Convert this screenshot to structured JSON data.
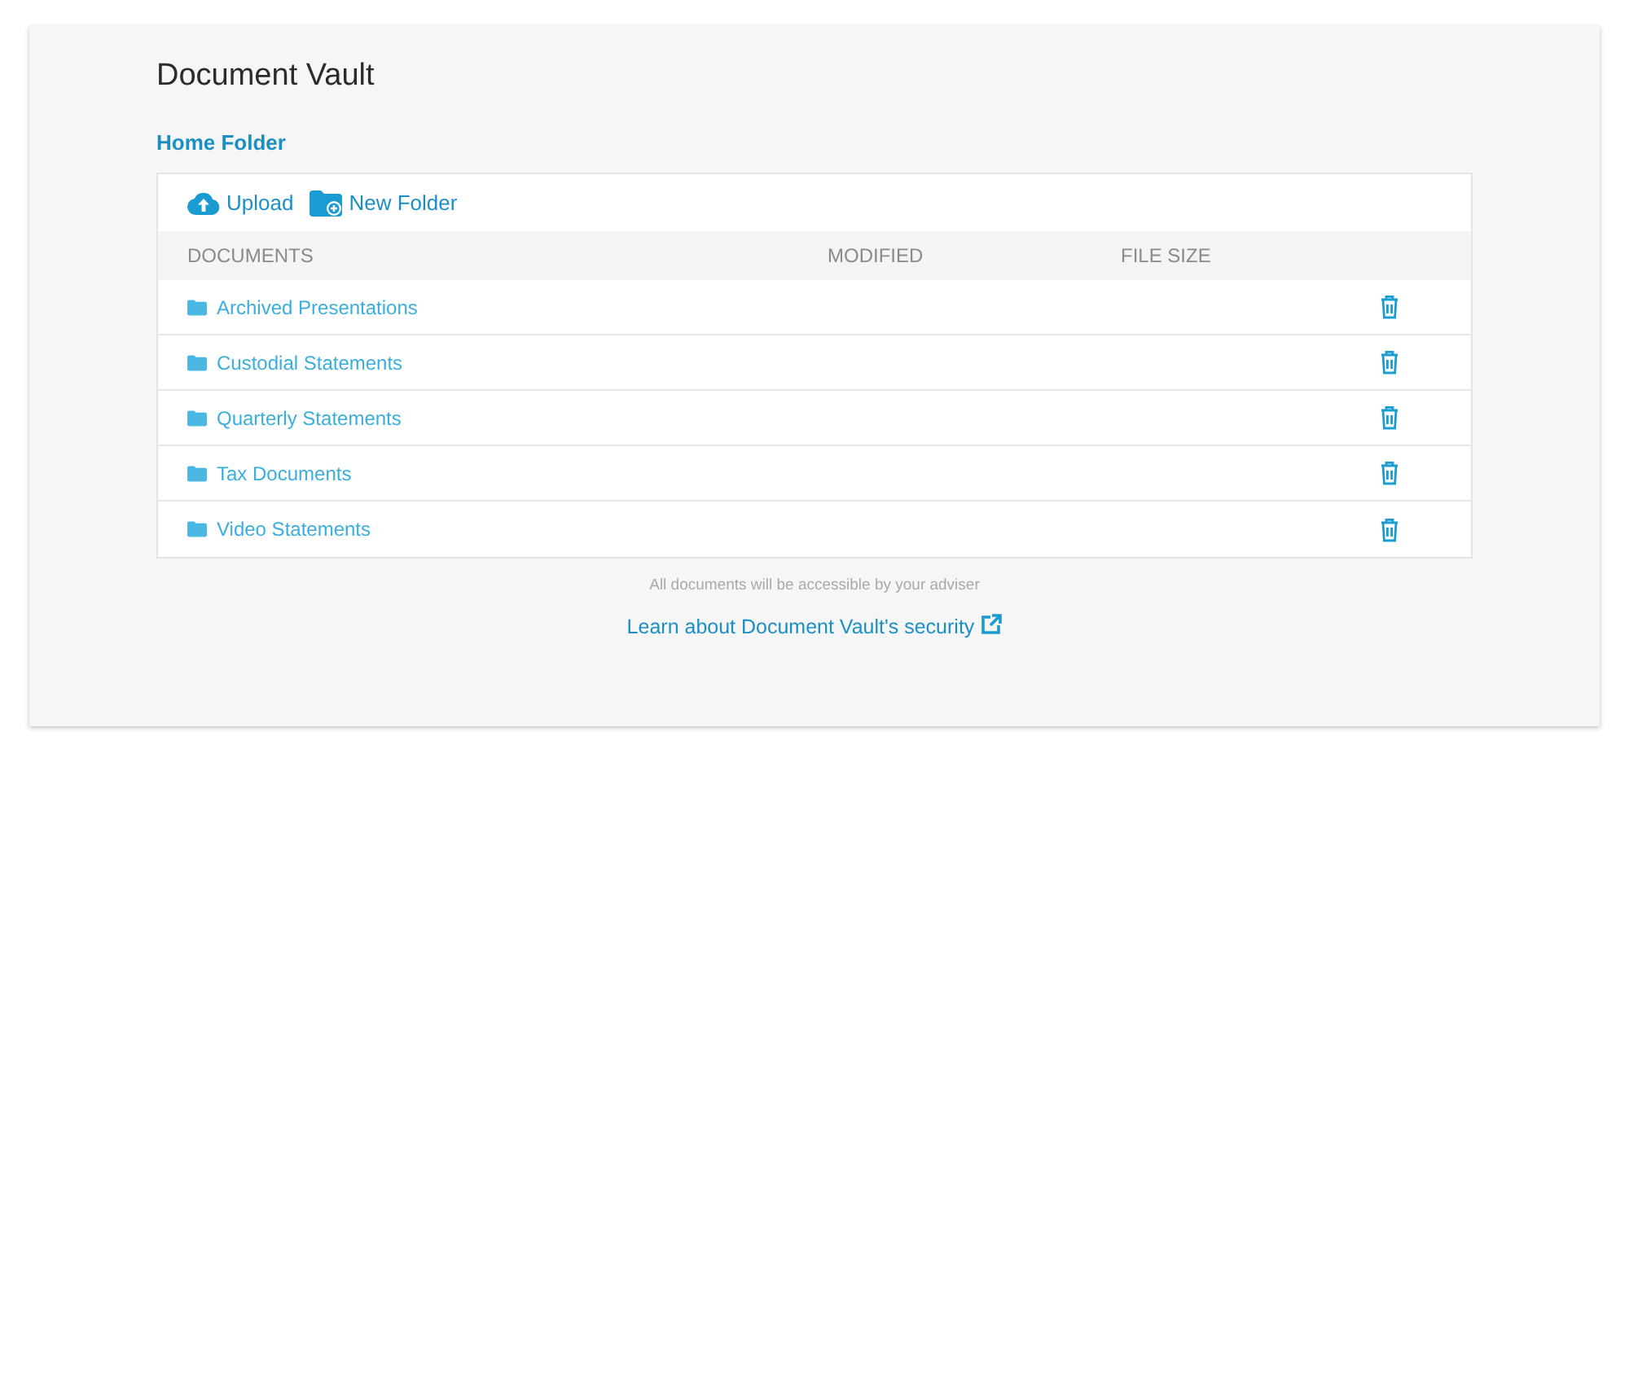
{
  "title": "Document Vault",
  "breadcrumb": "Home Folder",
  "toolbar": [
    {
      "kind": "upload",
      "label": "Upload"
    },
    {
      "kind": "new-folder",
      "label": "New Folder"
    }
  ],
  "table": {
    "columns": [
      "DOCUMENTS",
      "MODIFIED",
      "FILE SIZE"
    ],
    "rows": [
      {
        "kind": "folder",
        "name": "Archived Presentations"
      },
      {
        "kind": "folder",
        "name": "Custodial Statements"
      },
      {
        "kind": "folder",
        "name": "Quarterly Statements"
      },
      {
        "kind": "folder",
        "name": "Tax Documents"
      },
      {
        "kind": "folder",
        "name": "Video Statements"
      }
    ]
  },
  "note": "All documents will be accessible by your adviser",
  "security_link": "Learn about Document Vault's security"
}
